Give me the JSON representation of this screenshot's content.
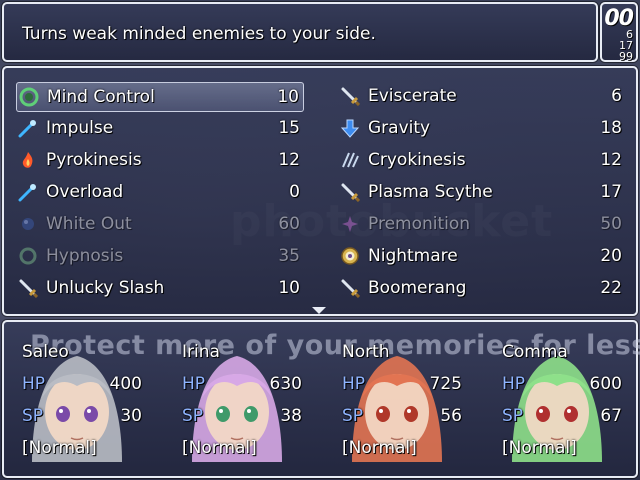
{
  "help": {
    "text": "Turns weak minded enemies to your side."
  },
  "counter": {
    "top": "00",
    "line1": "6",
    "line2": "17",
    "line3": "99"
  },
  "skills_left": [
    {
      "name": "Mind Control",
      "cost": "10",
      "icon": "mind-control-ring-icon",
      "disabled": false,
      "selected": true
    },
    {
      "name": "Impulse",
      "cost": "15",
      "icon": "comet-icon",
      "disabled": false,
      "selected": false
    },
    {
      "name": "Pyrokinesis",
      "cost": "12",
      "icon": "fire-icon",
      "disabled": false,
      "selected": false
    },
    {
      "name": "Overload",
      "cost": "0",
      "icon": "comet-icon",
      "disabled": false,
      "selected": false
    },
    {
      "name": "White Out",
      "cost": "60",
      "icon": "orb-icon",
      "disabled": true,
      "selected": false
    },
    {
      "name": "Hypnosis",
      "cost": "35",
      "icon": "ring-icon",
      "disabled": true,
      "selected": false
    },
    {
      "name": "Unlucky Slash",
      "cost": "10",
      "icon": "sword-icon",
      "disabled": false,
      "selected": false
    }
  ],
  "skills_right": [
    {
      "name": "Eviscerate",
      "cost": "6",
      "icon": "sword-icon",
      "disabled": false
    },
    {
      "name": "Gravity",
      "cost": "18",
      "icon": "down-arrow-icon",
      "disabled": false
    },
    {
      "name": "Cryokinesis",
      "cost": "12",
      "icon": "ice-icon",
      "disabled": false
    },
    {
      "name": "Plasma Scythe",
      "cost": "17",
      "icon": "sword-icon",
      "disabled": false
    },
    {
      "name": "Premonition",
      "cost": "50",
      "icon": "spark-icon",
      "disabled": true
    },
    {
      "name": "Nightmare",
      "cost": "20",
      "icon": "shield-emblem-icon",
      "disabled": false
    },
    {
      "name": "Boomerang",
      "cost": "22",
      "icon": "sword-icon",
      "disabled": false
    }
  ],
  "party_watermark": "Protect more of your memories for less!",
  "center_watermark": "photobucket",
  "party": [
    {
      "name": "Saleo",
      "hp_label": "HP",
      "hp": "400",
      "sp_label": "SP",
      "sp": "30",
      "state": "[Normal]",
      "hair": "#b9bcc4",
      "eyes": "#7a4aa8"
    },
    {
      "name": "Irina",
      "hp_label": "HP",
      "hp": "630",
      "sp_label": "SP",
      "sp": "38",
      "state": "[Normal]",
      "hair": "#d7a8e6",
      "eyes": "#3f9a6a"
    },
    {
      "name": "North",
      "hp_label": "HP",
      "hp": "725",
      "sp_label": "SP",
      "sp": "56",
      "state": "[Normal]",
      "hair": "#e27452",
      "eyes": "#b0382a"
    },
    {
      "name": "Comma",
      "hp_label": "HP",
      "hp": "600",
      "sp_label": "SP",
      "sp": "67",
      "state": "[Normal]",
      "hair": "#8ee08a",
      "eyes": "#b03030"
    }
  ]
}
